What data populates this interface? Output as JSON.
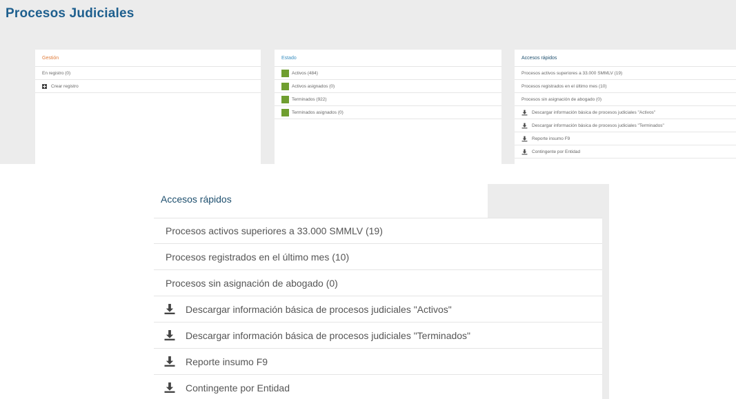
{
  "page_title": "Procesos Judiciales",
  "colors": {
    "title": "#1e5f8e",
    "gestion_head": "#e07b39",
    "estado_head": "#3a8fc0",
    "accesos_head": "#1e4f6e",
    "status_square": "#6f9e2f"
  },
  "gestion": {
    "title": "Gestión",
    "items": [
      {
        "label": "En registro (0)",
        "icon": ""
      },
      {
        "label": "Crear registro",
        "icon": "plus-square-icon"
      }
    ]
  },
  "estado": {
    "title": "Estado",
    "items": [
      {
        "label": "Activos (484)"
      },
      {
        "label": "Activos asignados (0)"
      },
      {
        "label": "Terminados (922)"
      },
      {
        "label": "Terminados asignados (0)"
      }
    ]
  },
  "accesos": {
    "title": "Accesos rápidos",
    "items": [
      {
        "label": "Procesos activos superiores a 33.000 SMMLV (19)",
        "icon": ""
      },
      {
        "label": "Procesos registrados en el último mes (10)",
        "icon": ""
      },
      {
        "label": "Procesos sin asignación de abogado (0)",
        "icon": ""
      },
      {
        "label": "Descargar información básica de procesos judiciales \"Activos\"",
        "icon": "download-icon"
      },
      {
        "label": "Descargar información básica de procesos judiciales \"Terminados\"",
        "icon": "download-icon"
      },
      {
        "label": "Reporte insumo F9",
        "icon": "download-icon"
      },
      {
        "label": "Contingente por Entidad",
        "icon": "download-icon"
      }
    ]
  }
}
